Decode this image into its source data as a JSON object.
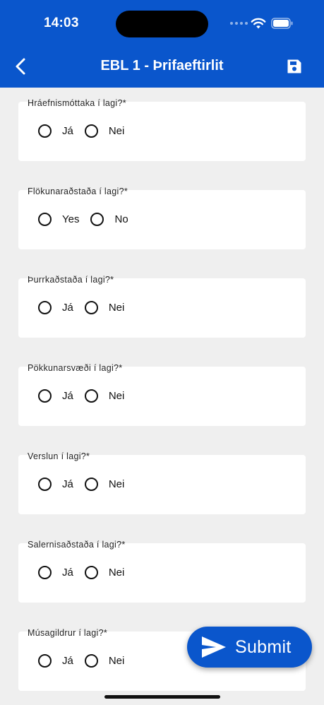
{
  "status": {
    "time": "14:03"
  },
  "header": {
    "title": "EBL 1 - Þrifaeftirlit"
  },
  "questions": [
    {
      "label": "Hráefnismóttaka í lagi?*",
      "options": [
        "Já",
        "Nei"
      ]
    },
    {
      "label": "Flökunaraðstaða í lagi?*",
      "options": [
        "Yes",
        "No"
      ]
    },
    {
      "label": "Þurrkaðstaða í lagi?*",
      "options": [
        "Já",
        "Nei"
      ]
    },
    {
      "label": "Pökkunarsvæði í lagi?*",
      "options": [
        "Já",
        "Nei"
      ]
    },
    {
      "label": "Verslun í lagi?*",
      "options": [
        "Já",
        "Nei"
      ]
    },
    {
      "label": "Salernisaðstaða í lagi?*",
      "options": [
        "Já",
        "Nei"
      ]
    },
    {
      "label": "Músagildrur í lagi?*",
      "options": [
        "Já",
        "Nei"
      ]
    }
  ],
  "submit": {
    "label": "Submit"
  },
  "colors": {
    "primary": "#0a56cc",
    "background": "#efefef",
    "card": "#ffffff"
  },
  "icons": {
    "back": "chevron-left-icon",
    "save": "floppy-disk-icon",
    "submit": "send-icon"
  }
}
